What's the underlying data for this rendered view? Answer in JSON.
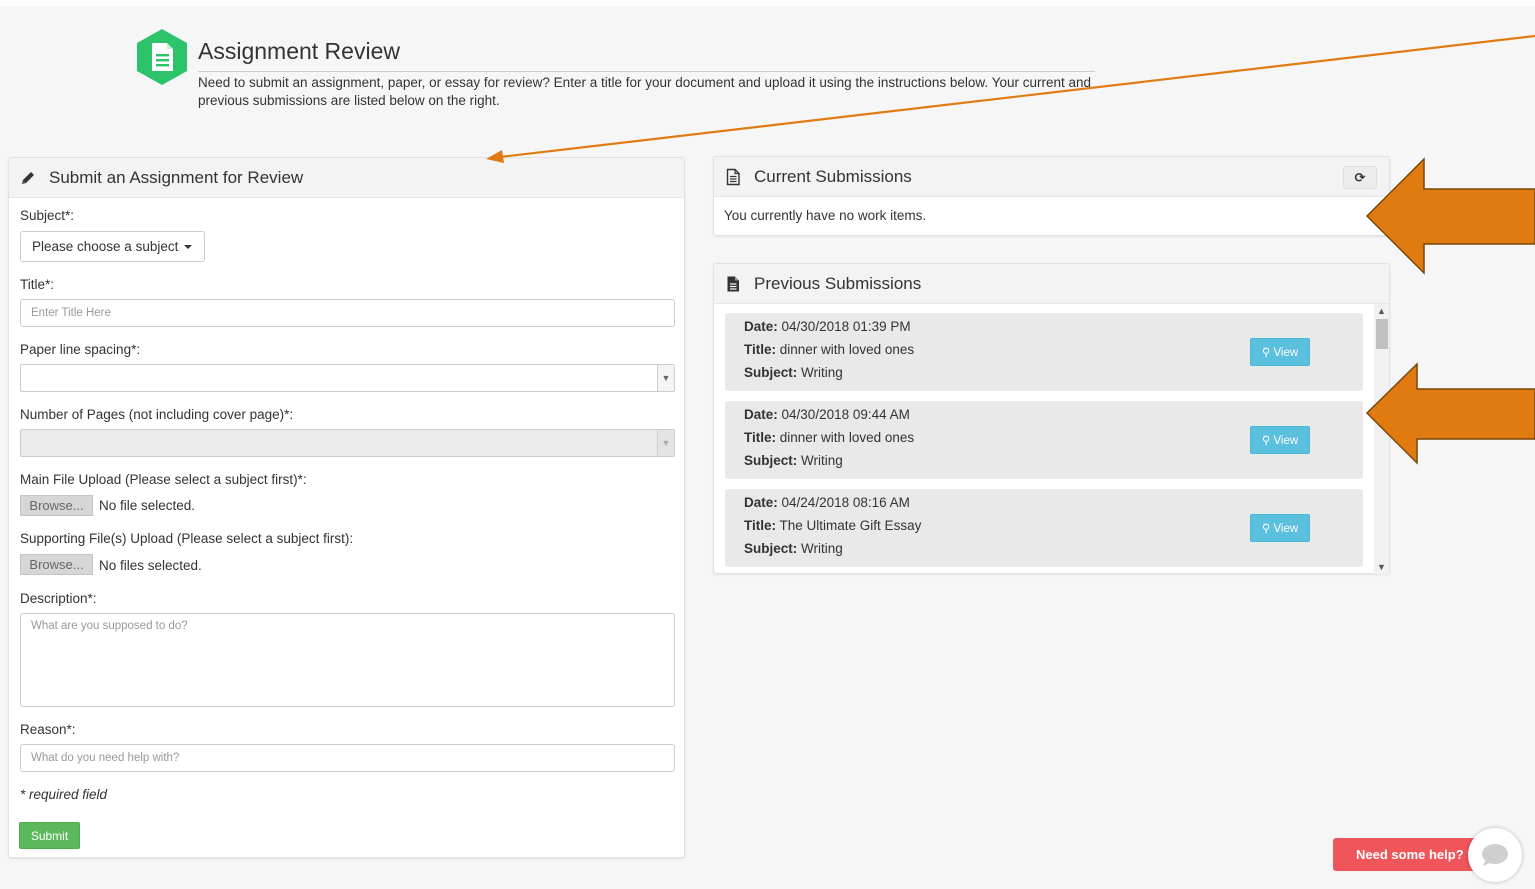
{
  "header": {
    "title": "Assignment Review",
    "description": "Need to submit an assignment, paper, or essay for review? Enter a title for your document and upload it using the instructions below. Your current and previous submissions are listed below on the right.",
    "icon": "document-icon",
    "accent_color": "#2cc36b"
  },
  "submit_form": {
    "panel_title": "Submit an Assignment for Review",
    "panel_icon": "pencil-icon",
    "subject_label": "Subject*:",
    "subject_button": "Please choose a subject",
    "title_label": "Title*:",
    "title_placeholder": "Enter Title Here",
    "title_value": "",
    "spacing_label": "Paper line spacing*:",
    "spacing_value": "",
    "pages_label": "Number of Pages (not including cover page)*:",
    "pages_value": "",
    "main_upload_label": "Main File Upload (Please select a subject first)*:",
    "main_browse": "Browse...",
    "main_status": "No file selected.",
    "support_upload_label": "Supporting File(s) Upload (Please select a subject first):",
    "support_browse": "Browse...",
    "support_status": "No files selected.",
    "description_label": "Description*:",
    "description_placeholder": "What are you supposed to do?",
    "reason_label": "Reason*:",
    "reason_placeholder": "What do you need help with?",
    "required_note": "* required field",
    "submit_label": "Submit",
    "submit_color": "#5cb85c"
  },
  "current_submissions": {
    "panel_title": "Current Submissions",
    "panel_icon": "file-outline-icon",
    "refresh_icon": "refresh-icon",
    "empty_message": "You currently have no work items."
  },
  "previous_submissions": {
    "panel_title": "Previous Submissions",
    "panel_icon": "file-solid-icon",
    "date_key": "Date:",
    "title_key": "Title:",
    "subject_key": "Subject:",
    "view_label": "View",
    "view_color": "#5bc0de",
    "items": [
      {
        "date": "04/30/2018 01:39 PM",
        "title": "dinner with loved ones",
        "subject": "Writing"
      },
      {
        "date": "04/30/2018 09:44 AM",
        "title": "dinner with loved ones",
        "subject": "Writing"
      },
      {
        "date": "04/24/2018 08:16 AM",
        "title": "The Ultimate Gift Essay",
        "subject": "Writing"
      }
    ]
  },
  "help_widget": {
    "label": "Need some help?",
    "color": "#f0555a",
    "icon": "chat-bubble-icon"
  },
  "annotations": {
    "arrow_color": "#e07b12"
  }
}
